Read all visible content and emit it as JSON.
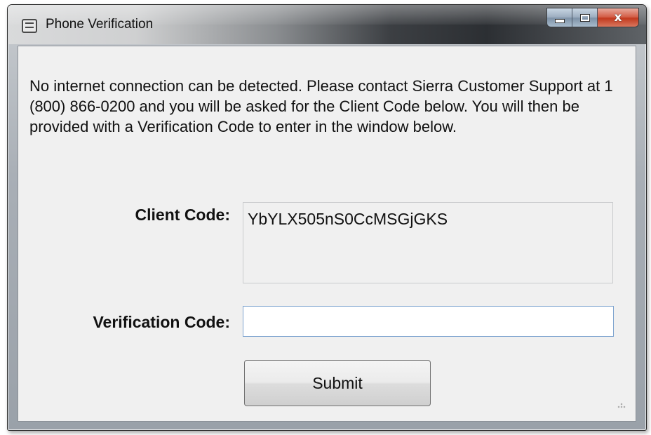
{
  "window": {
    "title": "Phone Verification",
    "app_icon": "app-icon",
    "caption_buttons": {
      "minimize": "minimize-icon",
      "maximize": "maximize-icon",
      "close": "close-icon",
      "close_glyph": "x"
    }
  },
  "message": "No internet connection can be detected. Please contact Sierra Customer Support at 1 (800) 866-0200 and you will be asked for the Client Code below. You will then be provided with a Verification Code to enter in the window below.",
  "client_code": {
    "label": "Client Code:",
    "value": "YbYLX505nS0CcMSGjGKS"
  },
  "verification_code": {
    "label": "Verification Code:",
    "value": "",
    "placeholder": ""
  },
  "submit": {
    "label": "Submit"
  },
  "colors": {
    "client_bg": "#f0f0f0",
    "close_button": "#c23a1f",
    "input_border": "#7ea4cf"
  }
}
